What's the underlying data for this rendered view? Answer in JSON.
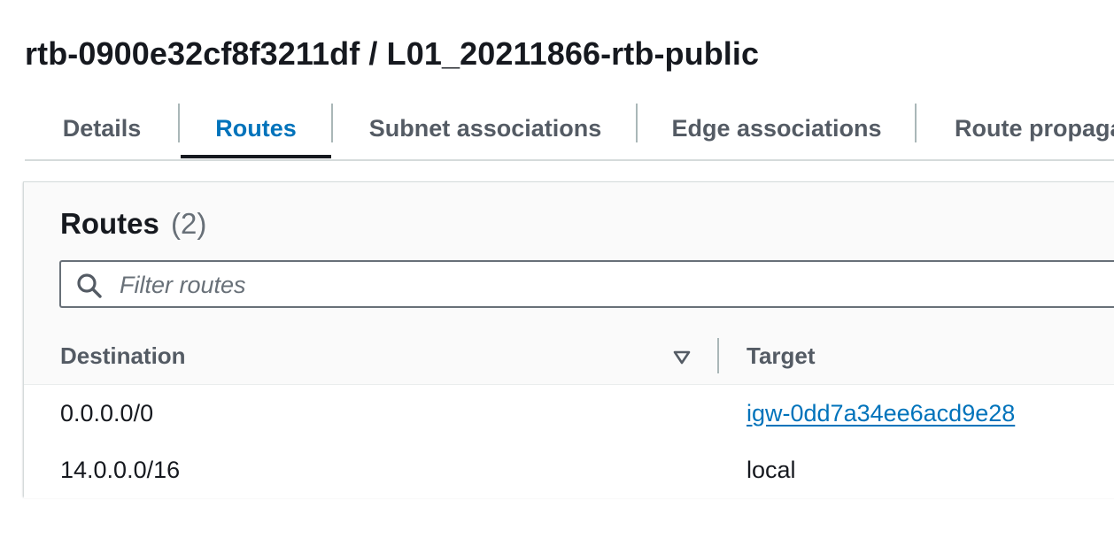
{
  "page": {
    "title": "rtb-0900e32cf8f3211df / L01_20211866-rtb-public"
  },
  "tabs": [
    {
      "label": "Details",
      "active": false
    },
    {
      "label": "Routes",
      "active": true
    },
    {
      "label": "Subnet associations",
      "active": false
    },
    {
      "label": "Edge associations",
      "active": false
    },
    {
      "label": "Route propaga",
      "active": false
    }
  ],
  "routes_panel": {
    "title": "Routes",
    "count": "(2)",
    "filter": {
      "placeholder": "Filter routes",
      "value": ""
    },
    "columns": {
      "destination": "Destination",
      "target": "Target"
    },
    "rows": [
      {
        "destination": "0.0.0.0/0",
        "target": "igw-0dd7a34ee6acd9e28",
        "target_is_link": true
      },
      {
        "destination": "14.0.0.0/16",
        "target": "local",
        "target_is_link": false
      }
    ]
  },
  "colors": {
    "active_tab": "#0073bb",
    "link": "#0073bb",
    "text": "#16191f",
    "muted": "#545b64"
  },
  "icons": {
    "filter": "search-icon",
    "sort": "sort-descending-icon"
  }
}
